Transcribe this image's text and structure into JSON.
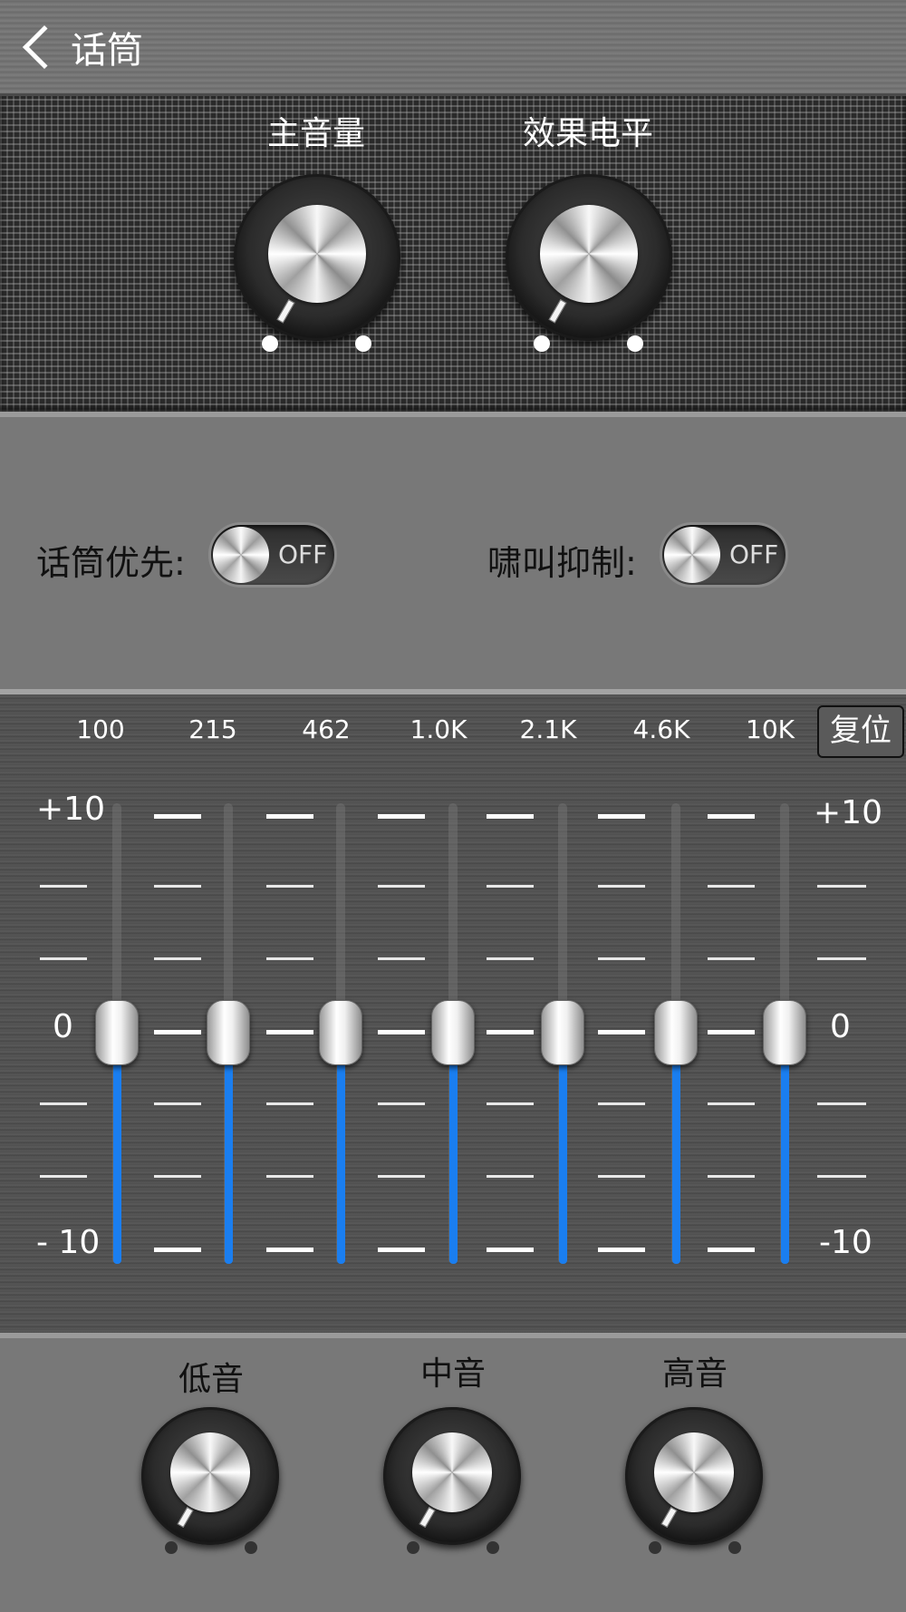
{
  "header": {
    "title": "话筒",
    "back_icon": "chevron-left-icon"
  },
  "top_knobs": [
    {
      "label": "主音量",
      "level": 0.0
    },
    {
      "label": "效果电平",
      "level": 0.0
    }
  ],
  "switches": [
    {
      "label": "话筒优先:",
      "state": "OFF"
    },
    {
      "label": "啸叫抑制:",
      "state": "OFF"
    }
  ],
  "equalizer": {
    "frequencies": [
      "100",
      "215",
      "462",
      "1.0K",
      "2.1K",
      "4.6K",
      "10K"
    ],
    "reset_label": "复位",
    "scale_max": "+10",
    "scale_zero": "0",
    "scale_min": "- 10",
    "scale_max_right": "+10",
    "scale_zero_right": "0",
    "scale_min_right": "-10",
    "band_values_db": [
      0,
      0,
      0,
      0,
      0,
      0,
      0
    ],
    "range_db": [
      -10,
      10
    ],
    "fill_color": "#1a7ef0"
  },
  "bottom_knobs": [
    {
      "label": "低音",
      "level": 0.0
    },
    {
      "label": "中音",
      "level": 0.0
    },
    {
      "label": "高音",
      "level": 0.0
    }
  ]
}
